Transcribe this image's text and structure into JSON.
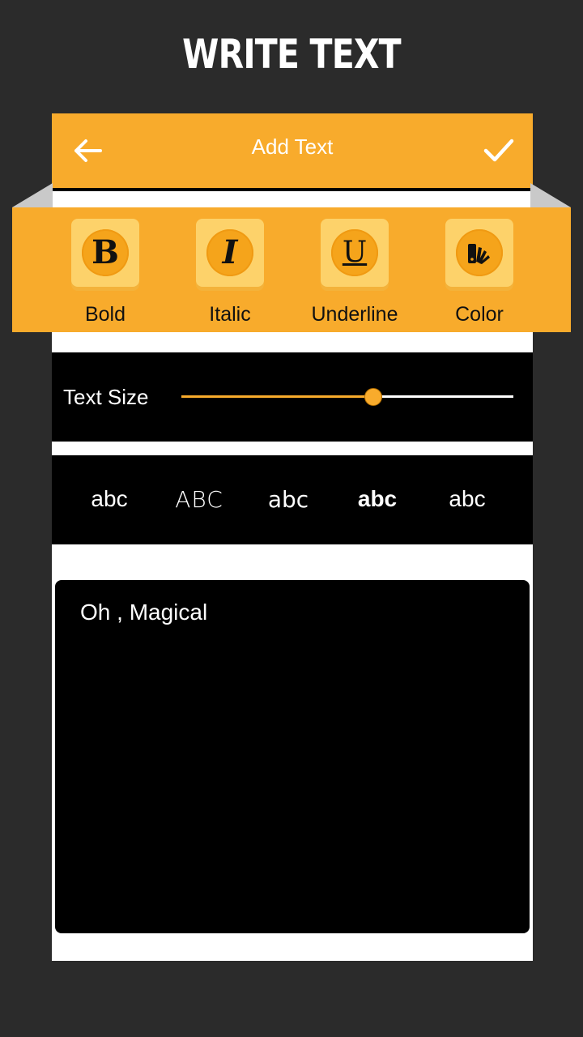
{
  "promo": {
    "title": "WRITE TEXT"
  },
  "app_bar": {
    "title": "Add Text",
    "back_icon": "arrow-left-icon",
    "done_icon": "checkmark-icon"
  },
  "style_tools": [
    {
      "label": "Bold",
      "glyph": "B",
      "icon": "bold-icon"
    },
    {
      "label": "Italic",
      "glyph": "I",
      "icon": "italic-icon"
    },
    {
      "label": "Underline",
      "glyph": "U",
      "icon": "underline-icon"
    },
    {
      "label": "Color",
      "glyph": "",
      "icon": "color-palette-icon"
    }
  ],
  "text_size": {
    "label": "Text Size",
    "value": 0.575
  },
  "fonts": [
    "abc",
    "ABC",
    "abc",
    "abc",
    "abc"
  ],
  "editor": {
    "text": "Oh , Magical"
  },
  "colors": {
    "accent": "#f8ab2c",
    "tile": "#fdd26a",
    "background": "#2b2b2b",
    "panel": "#000000"
  }
}
